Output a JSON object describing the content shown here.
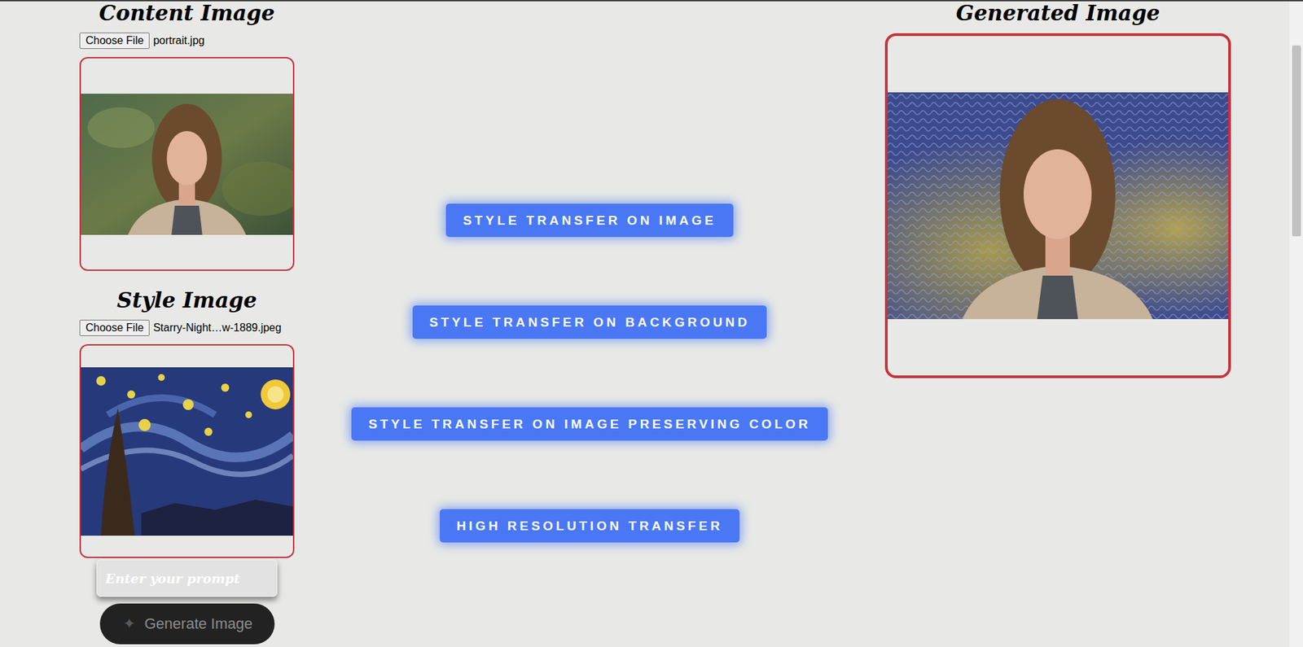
{
  "content": {
    "heading": "Content Image",
    "file_button": "Choose File",
    "file_name": "portrait.jpg"
  },
  "style": {
    "heading": "Style Image",
    "file_button": "Choose File",
    "file_name": "Starry-Night…w-1889.jpeg"
  },
  "prompt": {
    "placeholder": "Enter your prompt"
  },
  "generate_button": {
    "icon": "✦",
    "label": "Generate Image"
  },
  "actions": [
    "STYLE TRANSFER ON IMAGE",
    "STYLE TRANSFER ON BACKGROUND",
    "STYLE TRANSFER ON IMAGE PRESERVING COLOR",
    "HIGH RESOLUTION TRANSFER"
  ],
  "generated": {
    "heading": "Generated Image"
  }
}
